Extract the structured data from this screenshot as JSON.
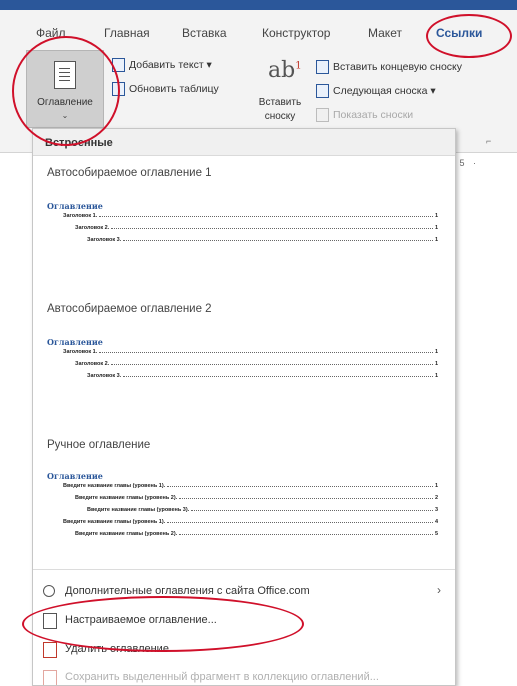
{
  "ribbon": {
    "tabs": [
      {
        "label": "Файл"
      },
      {
        "label": "Главная"
      },
      {
        "label": "Вставка"
      },
      {
        "label": "Конструктор"
      },
      {
        "label": "Макет"
      },
      {
        "label": "Ссылки"
      }
    ],
    "toc_button_label": "Оглавление",
    "toc_button_chevron": "⌄",
    "add_text_label": "Добавить текст ▾",
    "update_table_label": "Обновить таблицу",
    "insert_footnote_icon_text": "ab",
    "insert_footnote_sup": "1",
    "insert_footnote_label": "Вставить сноску",
    "insert_endnote_label": "Вставить концевую сноску",
    "next_footnote_label": "Следующая сноска ▾",
    "show_notes_label": "Показать сноски",
    "ruler_text": "· 5 ·",
    "collapse_mark": "⌐"
  },
  "dropdown": {
    "section_header": "Встроенные",
    "gallery": [
      {
        "title": "Автособираемое оглавление 1",
        "toc_heading": "Оглавление",
        "lines": [
          {
            "text": "Заголовок 1.",
            "page": "1"
          },
          {
            "text": "Заголовок 2.",
            "page": "1"
          },
          {
            "text": "Заголовок 3.",
            "page": "1"
          }
        ]
      },
      {
        "title": "Автособираемое оглавление 2",
        "toc_heading": "Оглавление",
        "lines": [
          {
            "text": "Заголовок 1.",
            "page": "1"
          },
          {
            "text": "Заголовок 2.",
            "page": "1"
          },
          {
            "text": "Заголовок 3.",
            "page": "1"
          }
        ]
      },
      {
        "title": "Ручное оглавление",
        "toc_heading": "Оглавление",
        "lines": [
          {
            "text": "Введите название главы (уровень 1).",
            "page": "1"
          },
          {
            "text": "Введите название главы (уровень 2).",
            "page": "2"
          },
          {
            "text": "Введите название главы (уровень 3).",
            "page": "3"
          },
          {
            "text": "Введите название главы (уровень 1).",
            "page": "4"
          },
          {
            "text": "Введите название главы (уровень 2).",
            "page": "5"
          }
        ]
      }
    ],
    "menu": [
      {
        "label": "Дополнительные оглавления с сайта Office.com",
        "arrow": "›"
      },
      {
        "label": "Настраиваемое оглавление..."
      },
      {
        "label": "Удалить оглавление"
      },
      {
        "label": "Сохранить выделенный фрагмент в коллекцию оглавлений..."
      }
    ]
  },
  "colors": {
    "accent": "#2b579a",
    "annotation": "#d0102a"
  }
}
